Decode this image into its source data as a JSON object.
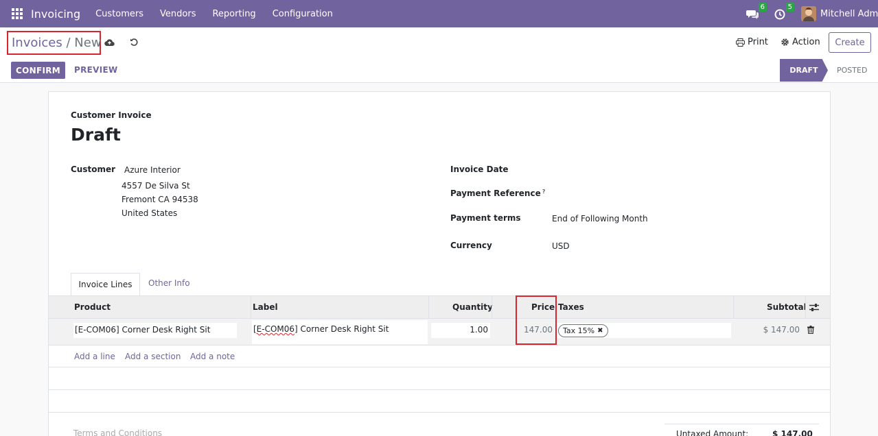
{
  "nav": {
    "brand": "Invoicing",
    "menu": [
      "Customers",
      "Vendors",
      "Reporting",
      "Configuration"
    ],
    "messages_count": "6",
    "activities_count": "5",
    "user": "Mitchell Admin"
  },
  "control": {
    "breadcrumb_parent": "Invoices",
    "breadcrumb_sep": "/",
    "breadcrumb_current": "New",
    "print_label": "Print",
    "action_label": "Action",
    "create_label": "Create",
    "confirm_label": "CONFIRM",
    "preview_label": "PREVIEW",
    "status_draft": "DRAFT",
    "status_posted": "POSTED"
  },
  "form": {
    "doc_type": "Customer Invoice",
    "doc_name": "Draft",
    "customer_label": "Customer",
    "customer_name": "Azure Interior",
    "address": [
      "4557 De Silva St",
      "Fremont CA 94538",
      "United States"
    ],
    "invoice_date_label": "Invoice Date",
    "payment_ref_label": "Payment Reference",
    "payment_ref_help": "?",
    "payment_terms_label": "Payment terms",
    "payment_terms_value": "End of Following Month",
    "currency_label": "Currency",
    "currency_value": "USD"
  },
  "tabs": [
    "Invoice Lines",
    "Other Info"
  ],
  "lines": {
    "headers": [
      "Product",
      "Label",
      "Quantity",
      "Price",
      "Taxes",
      "Subtotal"
    ],
    "rows": [
      {
        "product": "[E-COM06] Corner Desk Right Sit",
        "label_code": "[E-COM06]",
        "label_rest": " Corner Desk Right Sit",
        "quantity": "1.00",
        "price": "147.00",
        "tax": "Tax 15%",
        "subtotal": "$ 147.00"
      }
    ],
    "add_line": "Add a line",
    "add_section": "Add a section",
    "add_note": "Add a note"
  },
  "footer": {
    "terms_placeholder": "Terms and Conditions",
    "untaxed_label": "Untaxed Amount:",
    "untaxed_value": "$ 147.00"
  },
  "colors": {
    "brand": "#71639e",
    "highlight": "#d9232e",
    "badge": "#28a745"
  }
}
